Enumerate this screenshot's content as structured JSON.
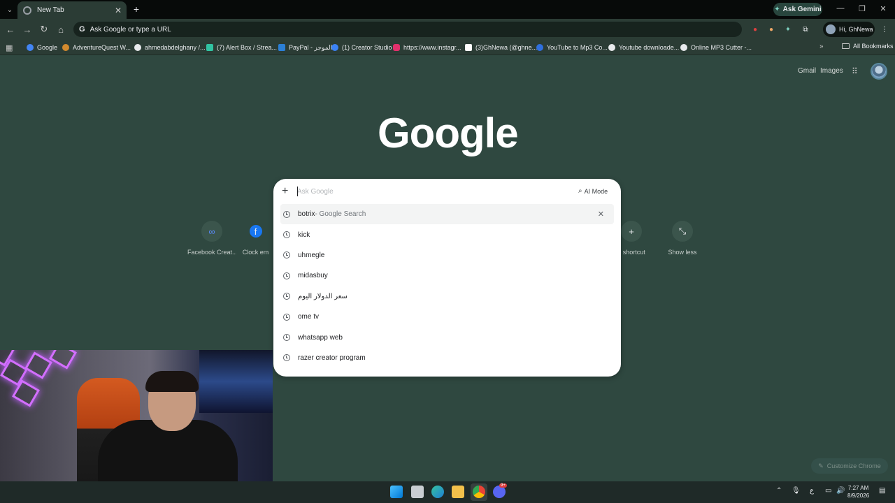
{
  "browser": {
    "tab_title": "New Tab",
    "ask_gemini": "Ask Gemini",
    "omnibox_text": "Ask Google or type a URL",
    "profile_name": "Hi, GhNewa",
    "accent": "#2b3c35",
    "page_bg": "#2f4840"
  },
  "bookmarks": [
    {
      "label": "Google",
      "icon": "google-icon",
      "color": "#4285f4"
    },
    {
      "label": "AdventureQuest W...",
      "icon": "aq-icon",
      "color": "#d38a2e"
    },
    {
      "label": "ahmedabdelghany /...",
      "icon": "github-icon",
      "color": "#e8eaed"
    },
    {
      "label": "(7) Alert Box / Strea...",
      "icon": "streamlabs-icon",
      "color": "#31c3a2"
    },
    {
      "label": "PayPal - الموجز",
      "icon": "paypal-icon",
      "color": "#2b7fd6"
    },
    {
      "label": "(1) Creator Studio",
      "icon": "meta-icon",
      "color": "#3b82f6"
    },
    {
      "label": "https://www.instagr...",
      "icon": "instagram-icon",
      "color": "#e1306c"
    },
    {
      "label": "(3)GhNewa (@ghne...",
      "icon": "tiktok-icon",
      "color": "#ffffff"
    },
    {
      "label": "YouTube to Mp3 Co...",
      "icon": "ytmp3-icon",
      "color": "#2f6fde"
    },
    {
      "label": "Youtube downloade...",
      "icon": "globe-icon",
      "color": "#e8eaed"
    },
    {
      "label": "Online MP3 Cutter -...",
      "icon": "globe-icon",
      "color": "#e8eaed"
    }
  ],
  "all_bookmarks": "All Bookmarks",
  "top_links": {
    "gmail": "Gmail",
    "images": "Images"
  },
  "logo": "Google",
  "shortcuts": [
    {
      "label": "Facebook Creat...",
      "glyph": "∞"
    },
    {
      "label": "Clock em",
      "glyph": "f"
    },
    {
      "label": "d shortcut",
      "glyph": "+"
    },
    {
      "label": "Show less",
      "glyph": "⤡"
    }
  ],
  "search": {
    "placeholder": "Ask Google",
    "ai_mode": "AI Mode",
    "suggestions": [
      {
        "text": "botrix",
        "suffix": " - Google Search"
      },
      {
        "text": "kick",
        "suffix": ""
      },
      {
        "text": "uhmegle",
        "suffix": ""
      },
      {
        "text": "midasbuy",
        "suffix": ""
      },
      {
        "text": "سعر الدولار اليوم",
        "suffix": ""
      },
      {
        "text": "ome tv",
        "suffix": ""
      },
      {
        "text": "whatsapp web",
        "suffix": ""
      },
      {
        "text": "razer creator program",
        "suffix": ""
      }
    ]
  },
  "customize_label": "Customize Chrome",
  "taskbar": {
    "time": "7:27 AM",
    "date": "8/9/2026",
    "lang": "ع",
    "discord_badge": "9+"
  }
}
